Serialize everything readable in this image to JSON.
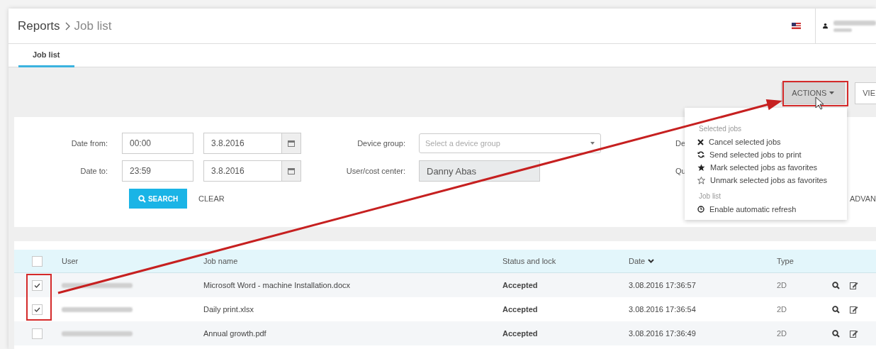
{
  "breadcrumb": [
    {
      "label": "Reports"
    },
    {
      "label": "Job list"
    }
  ],
  "tabs": [
    {
      "label": "Job list",
      "selected": true
    }
  ],
  "toolbar": {
    "buttons": [
      {
        "label": "ACTIONS",
        "open": true
      },
      {
        "label": "VIE",
        "open": false
      }
    ]
  },
  "actions_menu": {
    "sections": [
      {
        "title": "Selected jobs",
        "items": [
          {
            "label": "Cancel selected jobs",
            "kind": "cancel"
          },
          {
            "label": "Send selected jobs to print",
            "kind": "resend"
          },
          {
            "label": "Mark selected jobs as favorites",
            "kind": "mark"
          },
          {
            "label": "Unmark selected jobs as favorites",
            "kind": "unmark"
          }
        ]
      },
      {
        "title": "Job list",
        "items": [
          {
            "label": "Enable automatic refresh",
            "kind": "refresh"
          }
        ]
      }
    ]
  },
  "filters": {
    "date_from": {
      "label": "Date from:",
      "time": "00:00",
      "date": "3.8.2016"
    },
    "date_to": {
      "label": "Date to:",
      "time": "23:59",
      "date": "3.8.2016"
    },
    "device_group": {
      "label": "Device group:",
      "placeholder": "Select a device group"
    },
    "user_cost_center": {
      "label": "User/cost center:",
      "value": "Danny Abas",
      "disabled": true
    },
    "column_3_labels": [
      "De",
      "Qu"
    ],
    "search_button": "SEARCH",
    "clear_button": "CLEAR",
    "advanced_link": "ADVAN"
  },
  "table": {
    "columns": [
      {
        "label": "User"
      },
      {
        "label": "Job name"
      },
      {
        "label": "Status and lock"
      },
      {
        "label": "Date",
        "sorted": true
      },
      {
        "label": "Type"
      }
    ],
    "header_checked": false,
    "rows": [
      {
        "checked": true,
        "job": "Microsoft Word - machine Installation.docx",
        "status": "Accepted",
        "date": "3.08.2016 17:36:57",
        "type": "2D"
      },
      {
        "checked": true,
        "job": "Daily print.xlsx",
        "status": "Accepted",
        "date": "3.08.2016 17:36:54",
        "type": "2D"
      },
      {
        "checked": false,
        "job": "Annual growth.pdf",
        "status": "Accepted",
        "date": "3.08.2016 17:36:49",
        "type": "2D"
      }
    ]
  },
  "annotations": [
    {
      "kind": "box-actions"
    },
    {
      "kind": "box-checkboxes"
    },
    {
      "kind": "arrow"
    }
  ]
}
